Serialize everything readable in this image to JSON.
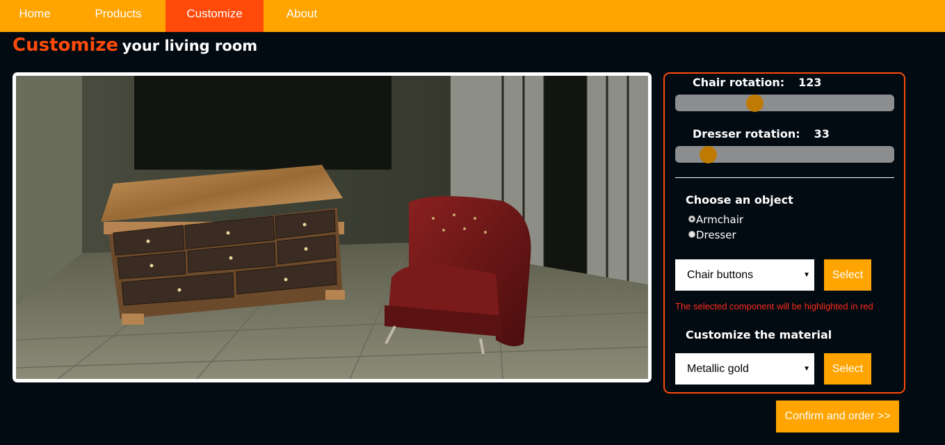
{
  "nav": {
    "items": [
      {
        "label": "Home",
        "active": false
      },
      {
        "label": "Products",
        "active": false
      },
      {
        "label": "Customize",
        "active": true
      },
      {
        "label": "About",
        "active": false
      }
    ]
  },
  "heading": {
    "accent": "Customize",
    "rest": "your living room"
  },
  "viewer": {
    "scene_objects": [
      "dresser",
      "armchair"
    ]
  },
  "controls": {
    "chair_rotation": {
      "label": "Chair rotation:",
      "value": "123",
      "fraction": 0.35
    },
    "dresser_rotation": {
      "label": "Dresser rotation:",
      "value": "33",
      "fraction": 0.12
    },
    "object_section_title": "Choose an object",
    "objects": [
      {
        "label": "Armchair",
        "checked": true
      },
      {
        "label": "Dresser",
        "checked": false
      }
    ],
    "component_select": {
      "value": "Chair buttons",
      "button": "Select"
    },
    "hint": "The selected component will be highlighted in red",
    "material_section_title": "Customize the material",
    "material_select": {
      "value": "Metallic gold",
      "button": "Select"
    }
  },
  "confirm_label": "Confirm and order >>",
  "colors": {
    "nav": "#ffa400",
    "accent": "#ff4a0a",
    "background": "#020b12",
    "slider_thumb": "#bf7a03",
    "hint": "#ff2a1a"
  }
}
